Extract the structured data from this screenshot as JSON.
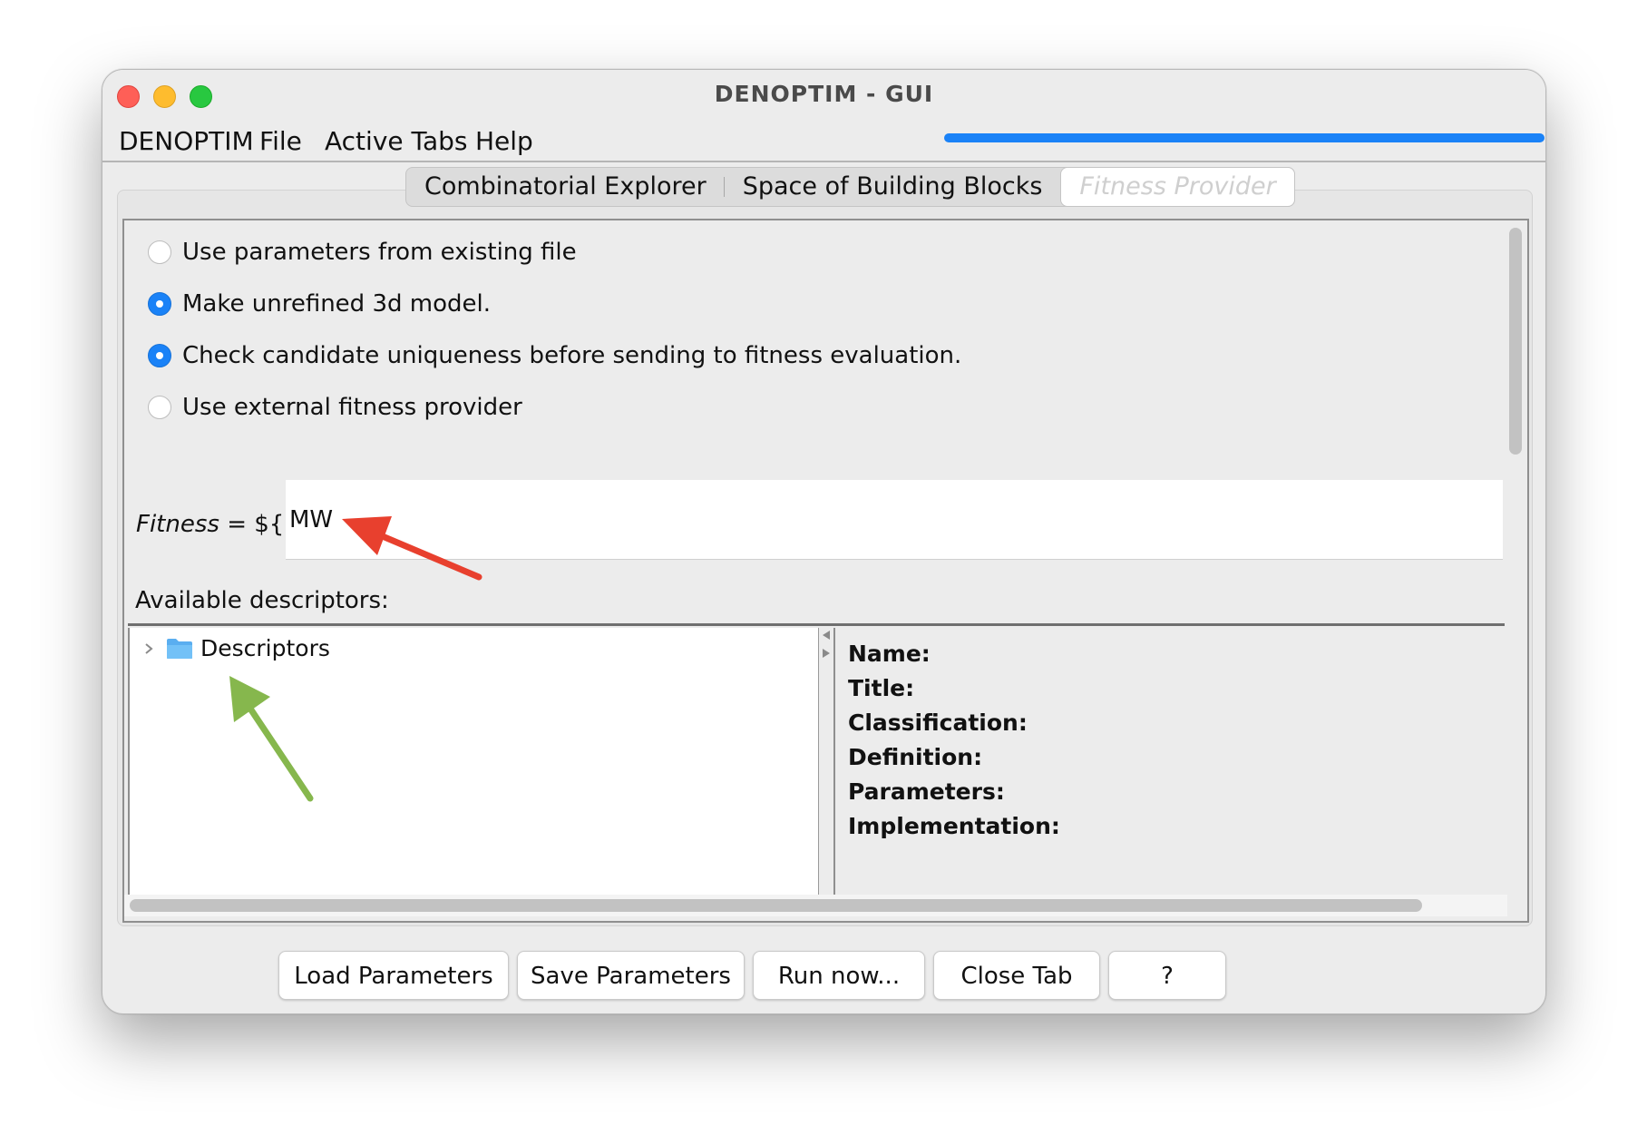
{
  "window": {
    "title": "DENOPTIM - GUI"
  },
  "menubar": {
    "items": [
      "DENOPTIM",
      "File",
      "Active Tabs",
      "Help"
    ],
    "progress": 1.0
  },
  "tabs": [
    {
      "label": "Combinatorial Explorer",
      "active": false
    },
    {
      "label": "Space of Building Blocks",
      "active": false
    },
    {
      "label": "Fitness Provider",
      "active": true
    }
  ],
  "options": [
    {
      "label": "Use parameters from existing file",
      "checked": false
    },
    {
      "label": "Make unrefined 3d model.",
      "checked": true
    },
    {
      "label": "Check candidate uniqueness before sending to fitness evaluation.",
      "checked": true
    },
    {
      "label": "Use external fitness provider",
      "checked": false
    }
  ],
  "fitness": {
    "label": "Fitness = ${",
    "value": "MW"
  },
  "descriptors": {
    "label": "Available descriptors:",
    "tree_root": "Descriptors",
    "info_fields": [
      "Name:",
      "Title:",
      "Classification:",
      "Definition:",
      "Parameters:",
      "Implementation:"
    ]
  },
  "buttons": [
    "Load Parameters",
    "Save Parameters",
    "Run now...",
    "Close Tab",
    "?"
  ],
  "colors": {
    "accent": "#1a82f7",
    "annotation_red": "#e8402e",
    "annotation_green": "#86b74d"
  }
}
